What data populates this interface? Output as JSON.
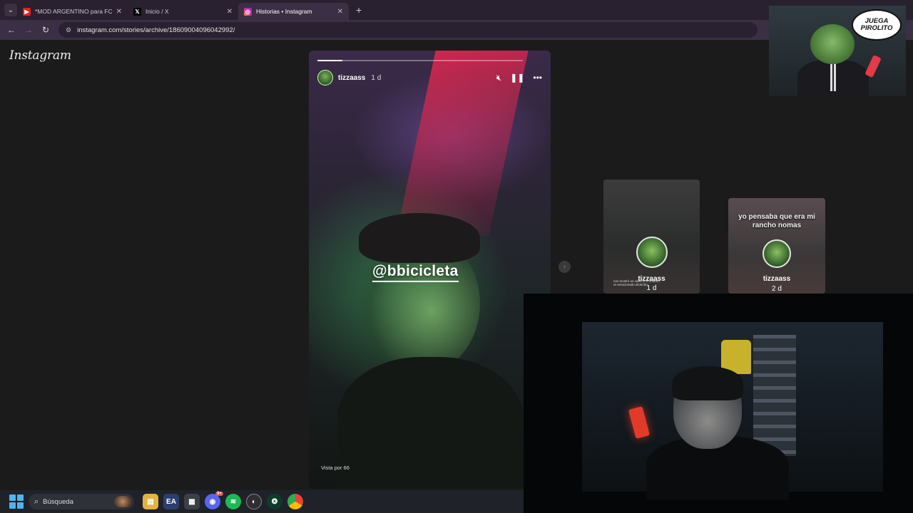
{
  "browser": {
    "tabs": [
      {
        "label": "*MOD ARGENTINO para FC",
        "favicon": "youtube-icon",
        "color": "#e62117",
        "active": false
      },
      {
        "label": "Inicio / X",
        "favicon": "x-icon",
        "color": "#000000",
        "active": false
      },
      {
        "label": "Historias • Instagram",
        "favicon": "instagram-icon",
        "color": "#d6249f",
        "active": true
      }
    ],
    "new_tab": "+",
    "url": "instagram.com/stories/archive/18609004096042992/"
  },
  "instagram": {
    "logo": "Instagram",
    "story": {
      "username": "tizzaass",
      "time": "1 d",
      "progress": 0.12,
      "mention": "@bbicicleta",
      "views": "Vista por 66"
    },
    "thumbnails": [
      {
        "username": "tizzaass",
        "time": "1 d",
        "text": "",
        "small_text": "nos mostró un video y el chabón re emocionado diciendo"
      },
      {
        "username": "tizzaass",
        "time": "2 d",
        "text": "yo pensaba que era mi rancho nomas",
        "small_text": ""
      }
    ]
  },
  "overlay": {
    "bubble_line1": "JUEGA",
    "bubble_line2": "PIROLITO"
  },
  "taskbar": {
    "search_placeholder": "Búsqueda",
    "discord_badge": "9+"
  },
  "colors": {
    "accent": "#3b2f45",
    "windows_blue": "#4fb3f6"
  }
}
